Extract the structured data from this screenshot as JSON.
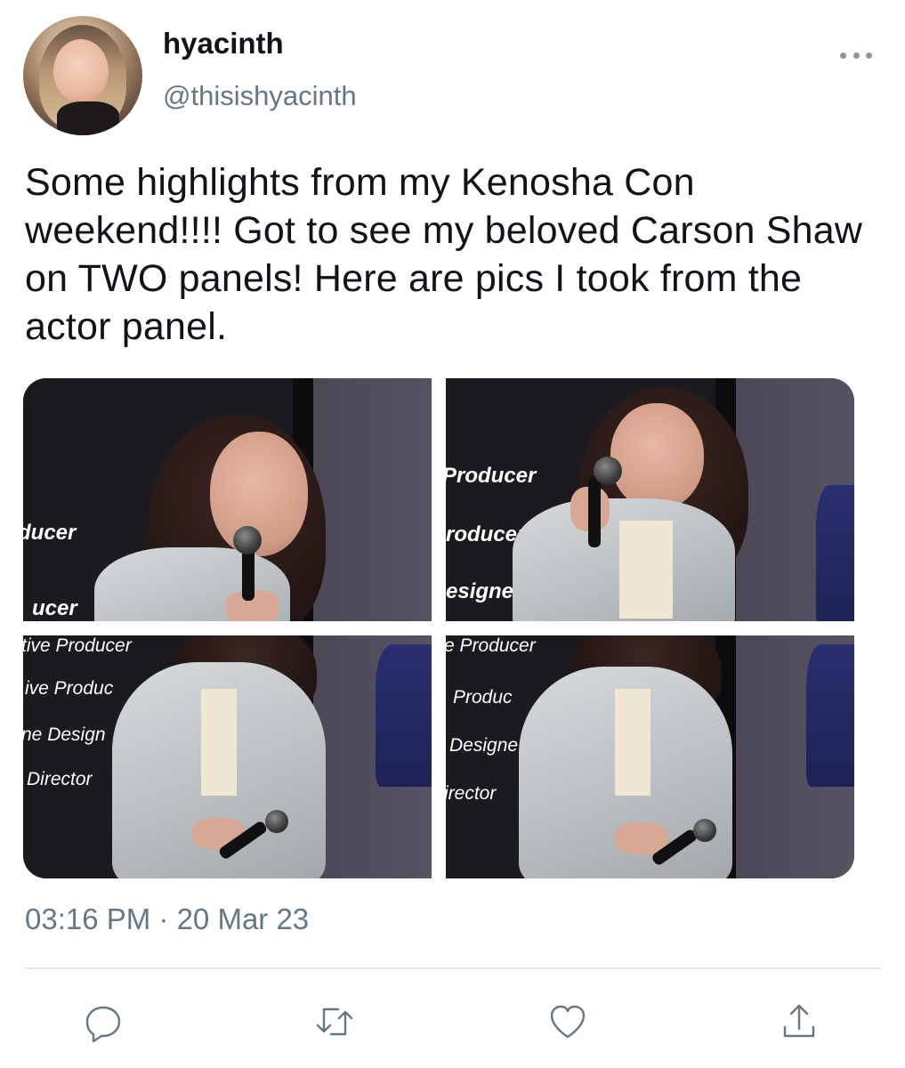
{
  "user": {
    "name": "hyacinth",
    "handle": "@thisishyacinth"
  },
  "tweet": {
    "text": "Some highlights from my Kenosha Con weekend!!!! Got to see my beloved Carson Shaw on TWO panels! Here are pics I took from the actor panel.",
    "timestamp": "03:16 PM · 20 Mar 23"
  },
  "media": {
    "photo1_banners": [
      "ducer",
      "ucer"
    ],
    "photo2_banners": [
      "Producer",
      "roducer",
      "esigne"
    ],
    "photo3_banners": [
      "tive Producer",
      "ive Produc",
      "ne Design",
      "Director"
    ],
    "photo4_banners": [
      "e Producer",
      "Produc",
      "Designe",
      "irector"
    ]
  },
  "actions": {
    "reply_icon": "reply-icon",
    "retweet_icon": "retweet-icon",
    "like_icon": "heart-icon",
    "share_icon": "share-icon"
  },
  "colors": {
    "secondary_text": "#657786",
    "divider": "#e1e8ed"
  }
}
